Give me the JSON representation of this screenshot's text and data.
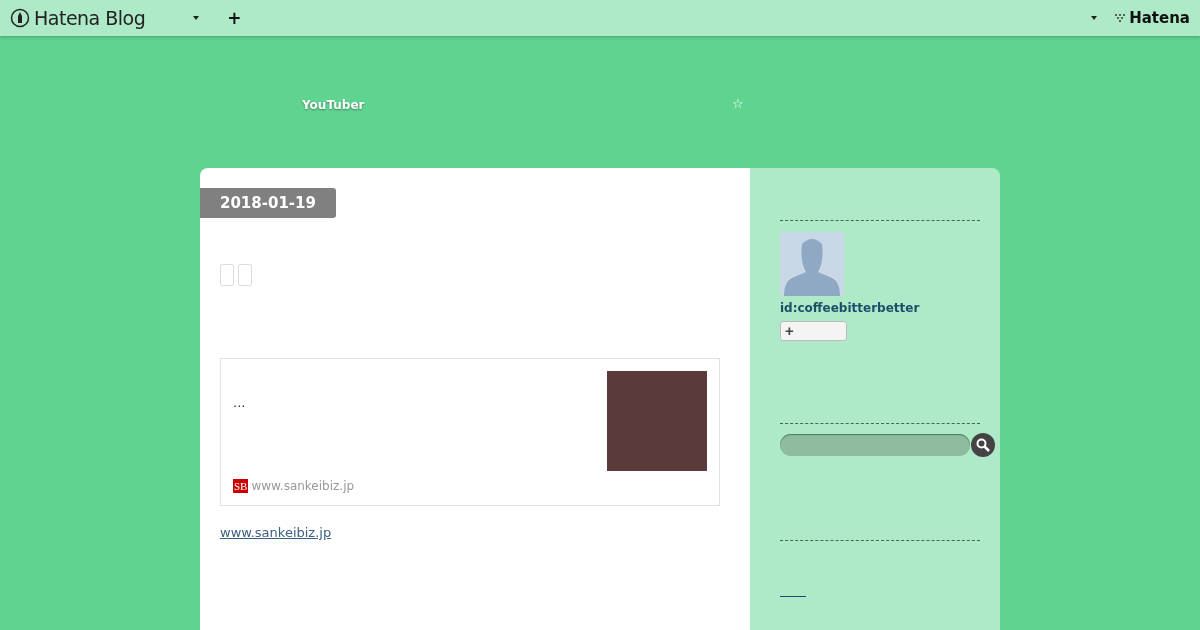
{
  "topbar": {
    "brand": "Hatena Blog",
    "add": "+",
    "logo": "Hatena"
  },
  "header": {
    "title": "YouTuber",
    "star": "☆"
  },
  "entry": {
    "date": "2018-01-19",
    "embed": {
      "excerpt": "...",
      "favicon": "SB",
      "site": "www.sankeibiz.jp"
    },
    "link": "www.sankeibiz.jp"
  },
  "sidebar": {
    "user_id": "id:coffeebitterbetter",
    "follow": "+"
  }
}
